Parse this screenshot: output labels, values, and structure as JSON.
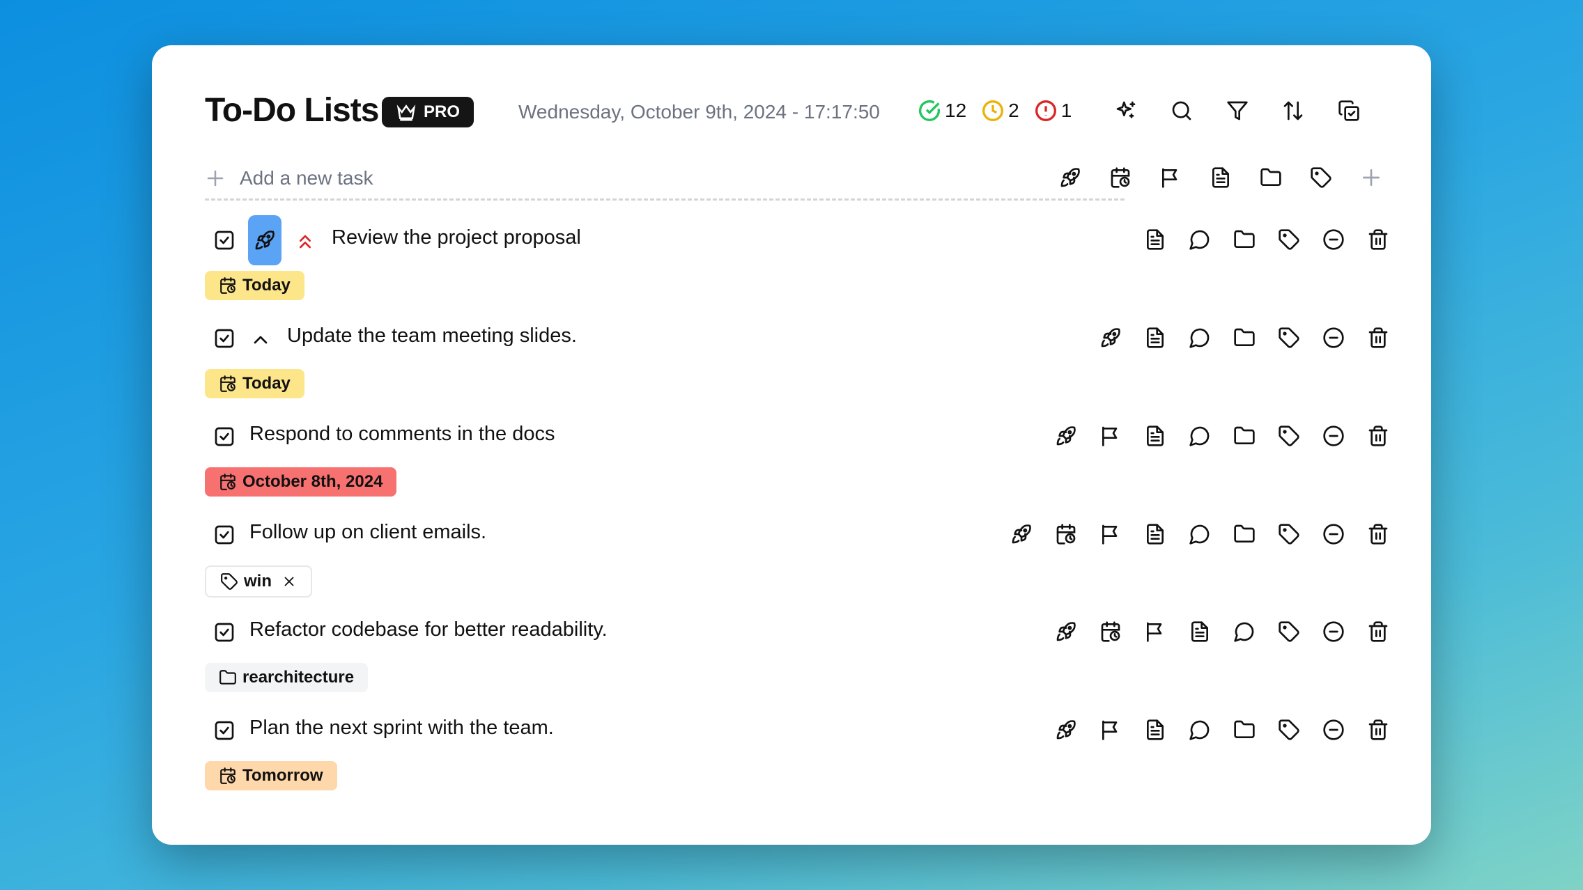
{
  "header": {
    "title": "To-Do Lists",
    "badge": "PRO",
    "datetime": "Wednesday, October 9th, 2024 - 17:17:50",
    "stats": {
      "completed": "12",
      "pending": "2",
      "overdue": "1"
    },
    "colors": {
      "completed": "#22c55e",
      "pending": "#eab308",
      "overdue": "#dc2626"
    }
  },
  "add_task": {
    "placeholder": "Add a new task"
  },
  "tasks": [
    {
      "text": "Review the project proposal",
      "priority": "high",
      "tag": "Today",
      "tag_type": "due-date"
    },
    {
      "text": "Update the team meeting slides.",
      "priority": "medium",
      "tag": "Today",
      "tag_type": "due-date"
    },
    {
      "text": "Respond to comments in the docs",
      "priority": "none",
      "tag": "October 8th, 2024",
      "tag_type": "due-date-overdue"
    },
    {
      "text": "Follow up on client emails.",
      "priority": "none",
      "tag": "win",
      "tag_type": "label"
    },
    {
      "text": "Refactor codebase for better readability.",
      "priority": "none",
      "tag": "rearchitecture",
      "tag_type": "folder"
    },
    {
      "text": "Plan the next sprint with the team.",
      "priority": "none",
      "tag": "Tomorrow",
      "tag_type": "due-date"
    }
  ],
  "tag_colors": {
    "today": "#fde68a",
    "overdue": "#f87171",
    "tomorrow": "#fed7aa",
    "rocket_active": "#5aa3f5"
  }
}
